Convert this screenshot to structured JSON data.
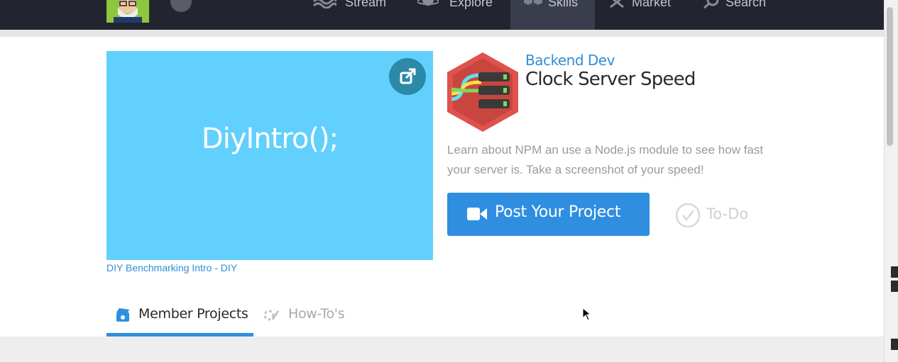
{
  "nav": {
    "items": [
      {
        "label": "Stream",
        "icon": "stream-icon"
      },
      {
        "label": "Explore",
        "icon": "planet-icon"
      },
      {
        "label": "Skills",
        "icon": "hexagons-icon",
        "active": true
      },
      {
        "label": "Market",
        "icon": "tools-icon"
      },
      {
        "label": "Search",
        "icon": "magnifier-icon"
      }
    ]
  },
  "video": {
    "title": "DiyIntro();",
    "caption": "DIY Benchmarking Intro - DIY"
  },
  "skill": {
    "category": "Backend Dev",
    "title": "Clock Server Speed",
    "description": "Learn about NPM an use a Node.js module to see how fast your server is. Take a screenshot of your speed!"
  },
  "actions": {
    "post_label": "Post Your Project",
    "todo_label": "To-Do"
  },
  "tabs": [
    {
      "label": "Member Projects",
      "active": true
    },
    {
      "label": "How-To's",
      "active": false
    }
  ],
  "colors": {
    "nav_bg": "#22252f",
    "accent": "#2f8ee0",
    "video_bg": "#62d0fc",
    "hex_red": "#e0524d"
  }
}
